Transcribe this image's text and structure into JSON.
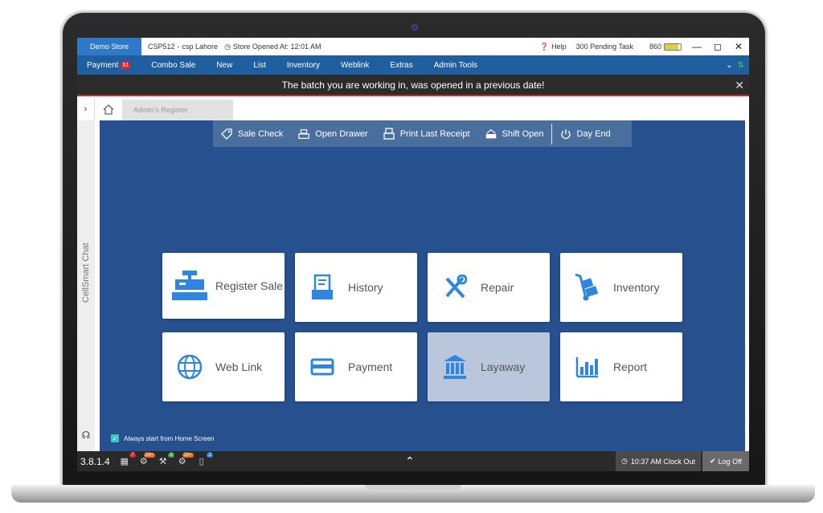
{
  "titlebar": {
    "store_badge": "Demo Store",
    "store_code": "CSP512",
    "separator": "-",
    "store_name": "csp Lahore",
    "store_opened": "Store Opened At: 12:01 AM",
    "help": "Help",
    "pending": "300 Pending Task",
    "battery_value": "860"
  },
  "menubar": {
    "items": [
      {
        "label": "Payment",
        "badge": "51"
      },
      {
        "label": "Combo Sale"
      },
      {
        "label": "New"
      },
      {
        "label": "List"
      },
      {
        "label": "Inventory"
      },
      {
        "label": "Weblink"
      },
      {
        "label": "Extras"
      },
      {
        "label": "Admin Tools"
      }
    ]
  },
  "alert": {
    "message": "The batch you are working in, was opened in a previous date!"
  },
  "tabs": {
    "register_tab": "Admin's Register"
  },
  "sidebar": {
    "chat_label": "CellSmart Chat"
  },
  "toolbar": {
    "sale_check": "Sale Check",
    "open_drawer": "Open Drawer",
    "print_last_receipt": "Print Last Receipt",
    "shift_open": "Shift Open",
    "day_end": "Day End"
  },
  "tiles": [
    {
      "label": "Register Sale",
      "icon": "cash-register-icon"
    },
    {
      "label": "History",
      "icon": "history-icon"
    },
    {
      "label": "Repair",
      "icon": "tools-icon"
    },
    {
      "label": "Inventory",
      "icon": "hand-truck-icon"
    },
    {
      "label": "Web Link",
      "icon": "globe-icon"
    },
    {
      "label": "Payment",
      "icon": "card-icon"
    },
    {
      "label": "Layaway",
      "icon": "bank-icon"
    },
    {
      "label": "Report",
      "icon": "bar-chart-icon"
    }
  ],
  "home_screen": {
    "always_start": "Always start from Home Screen"
  },
  "statusbar": {
    "version": "3.8.1.4",
    "badges": [
      "7",
      "10+",
      "3",
      "10+",
      "2"
    ],
    "clock_out": "10:37 AM Clock Out",
    "log_off": "Log Off"
  },
  "colors": {
    "primary": "#1f5fa0",
    "workspace": "#26508e",
    "tile_icon": "#2e86de",
    "alert_border": "#d32a2a"
  }
}
